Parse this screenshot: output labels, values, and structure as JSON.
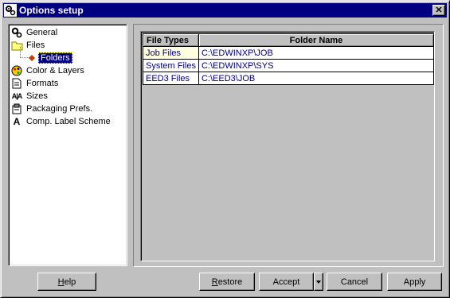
{
  "window": {
    "title": "Options setup",
    "close_label": "✕"
  },
  "tree": {
    "items": [
      {
        "label": "General",
        "icon": "gear-icon"
      },
      {
        "label": "Files",
        "icon": "folder-icon"
      },
      {
        "label": "Folders",
        "icon": "diamond-icon",
        "selected": true
      },
      {
        "label": "Color & Layers",
        "icon": "palette-icon"
      },
      {
        "label": "Formats",
        "icon": "page-icon"
      },
      {
        "label": "Sizes",
        "icon": "sizes-icon",
        "glyph": "A|A"
      },
      {
        "label": "Packaging Prefs.",
        "icon": "package-icon"
      },
      {
        "label": "Comp. Label Scheme",
        "icon": "letter-a-icon",
        "glyph": "A"
      }
    ]
  },
  "table": {
    "columns": [
      "File Types",
      "Folder Name"
    ],
    "rows": [
      {
        "type": "Job Files",
        "folder": "C:\\EDWINXP\\JOB"
      },
      {
        "type": "System Files",
        "folder": "C:\\EDWINXP\\SYS"
      },
      {
        "type": "EED3 Files",
        "folder": "C:\\EED3\\JOB"
      }
    ]
  },
  "buttons": {
    "help": {
      "first": "H",
      "rest": "elp"
    },
    "restore": {
      "first": "R",
      "rest": "estore"
    },
    "accept": "Accept",
    "cancel": "Cancel",
    "apply": "Apply"
  },
  "colors": {
    "titlebar": "#000080",
    "face": "#c0c0c0",
    "cell_text": "#000080"
  }
}
